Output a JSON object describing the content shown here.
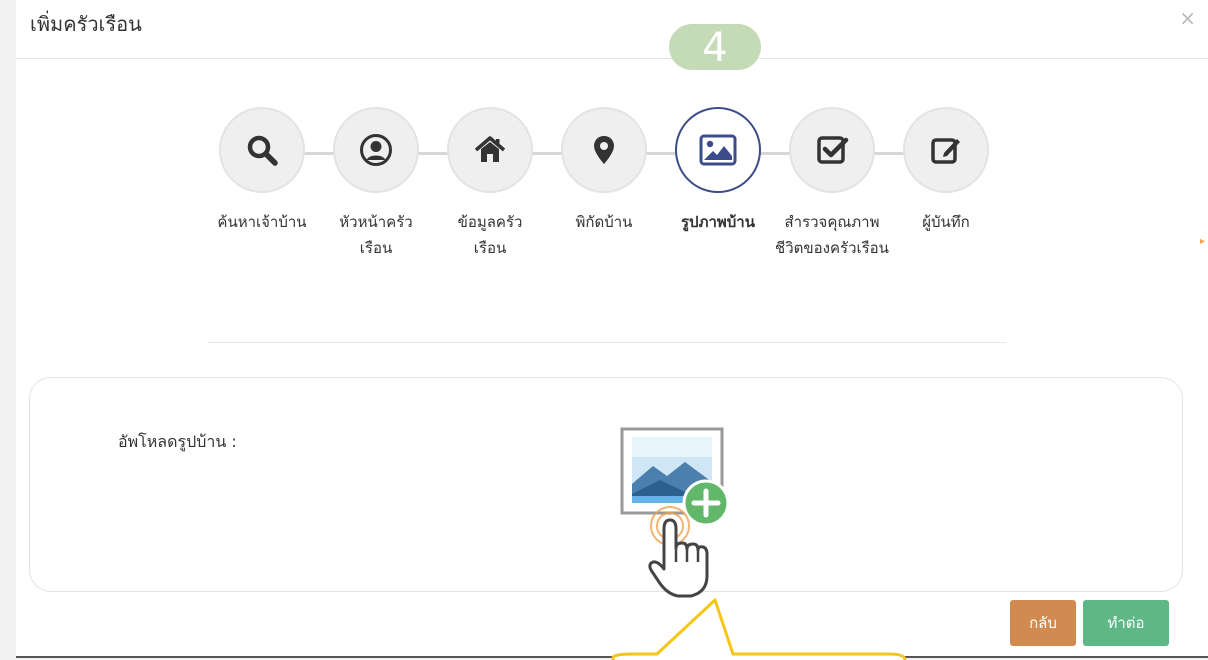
{
  "modal": {
    "title": "เพิ่มครัวเรือน",
    "close_symbol": "×"
  },
  "wizard": {
    "current_step_number": "4",
    "steps": [
      {
        "label": "ค้นหาเจ้าบ้าน",
        "icon": "search-icon",
        "active": false
      },
      {
        "label": "หัวหน้าครัวเรือน",
        "icon": "user-circle-icon",
        "active": false
      },
      {
        "label": "ข้อมูลครัวเรือน",
        "icon": "home-icon",
        "active": false
      },
      {
        "label": "พิกัดบ้าน",
        "icon": "map-pin-icon",
        "active": false
      },
      {
        "label": "รูปภาพบ้าน",
        "icon": "image-icon",
        "active": true
      },
      {
        "label": "สำรวจคุณภาพชีวิตของครัวเรือน",
        "icon": "check-square-icon",
        "active": false
      },
      {
        "label": "ผู้บันทึก",
        "icon": "edit-icon",
        "active": false
      }
    ],
    "active_color": "#3c4c8a",
    "step_number_color": "#c5dab6"
  },
  "upload": {
    "label": "อัพโหลดรูปบ้าน :",
    "graphic_icon": "image-add-icon",
    "cursor_icon": "hand-pointer-icon"
  },
  "buttons": {
    "back_label": "กลับ",
    "next_label": "ทำต่อ",
    "back_color": "#d18a4f",
    "next_color": "#5db886"
  },
  "callout_color": "#f5c518"
}
